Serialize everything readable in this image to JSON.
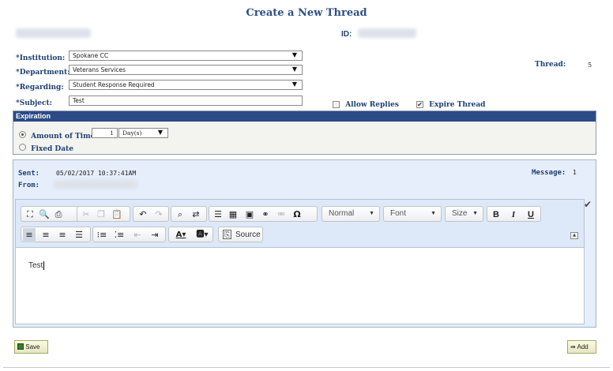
{
  "page_title": "Create a New Thread",
  "header": {
    "id_label": "ID:"
  },
  "form": {
    "institution_label": "*Institution:",
    "institution_value": "Spokane CC",
    "department_label": "*Department:",
    "department_value": "Veterans Services",
    "regarding_label": "*Regarding:",
    "regarding_value": "Student Response Required",
    "subject_label": "*Subject:",
    "subject_value": "Test",
    "thread_label": "Thread:",
    "thread_value": "5",
    "allow_replies_label": "Allow Replies",
    "allow_replies_checked": false,
    "expire_thread_label": "Expire Thread",
    "expire_thread_checked": true
  },
  "expiration": {
    "title": "Expiration",
    "amount_of_time_label": "Amount of Time",
    "amount_value": "1",
    "unit_value": "Day(s)",
    "fixed_date_label": "Fixed Date",
    "selected": "amount_of_time"
  },
  "message": {
    "sent_label": "Sent:",
    "sent_value": "05/02/2017 10:37:41AM",
    "from_label": "From:",
    "message_label": "Message:",
    "message_value": "1"
  },
  "editor": {
    "format_combo": "Normal",
    "font_combo": "Font",
    "size_combo": "Size",
    "source_label": "Source",
    "body_text": "Test"
  },
  "buttons": {
    "save": "Save",
    "add": "Add"
  },
  "colors": {
    "accent": "#2b4a86",
    "label": "#1f4173",
    "panel": "#e6eefb",
    "button": "#e9e9c8"
  }
}
